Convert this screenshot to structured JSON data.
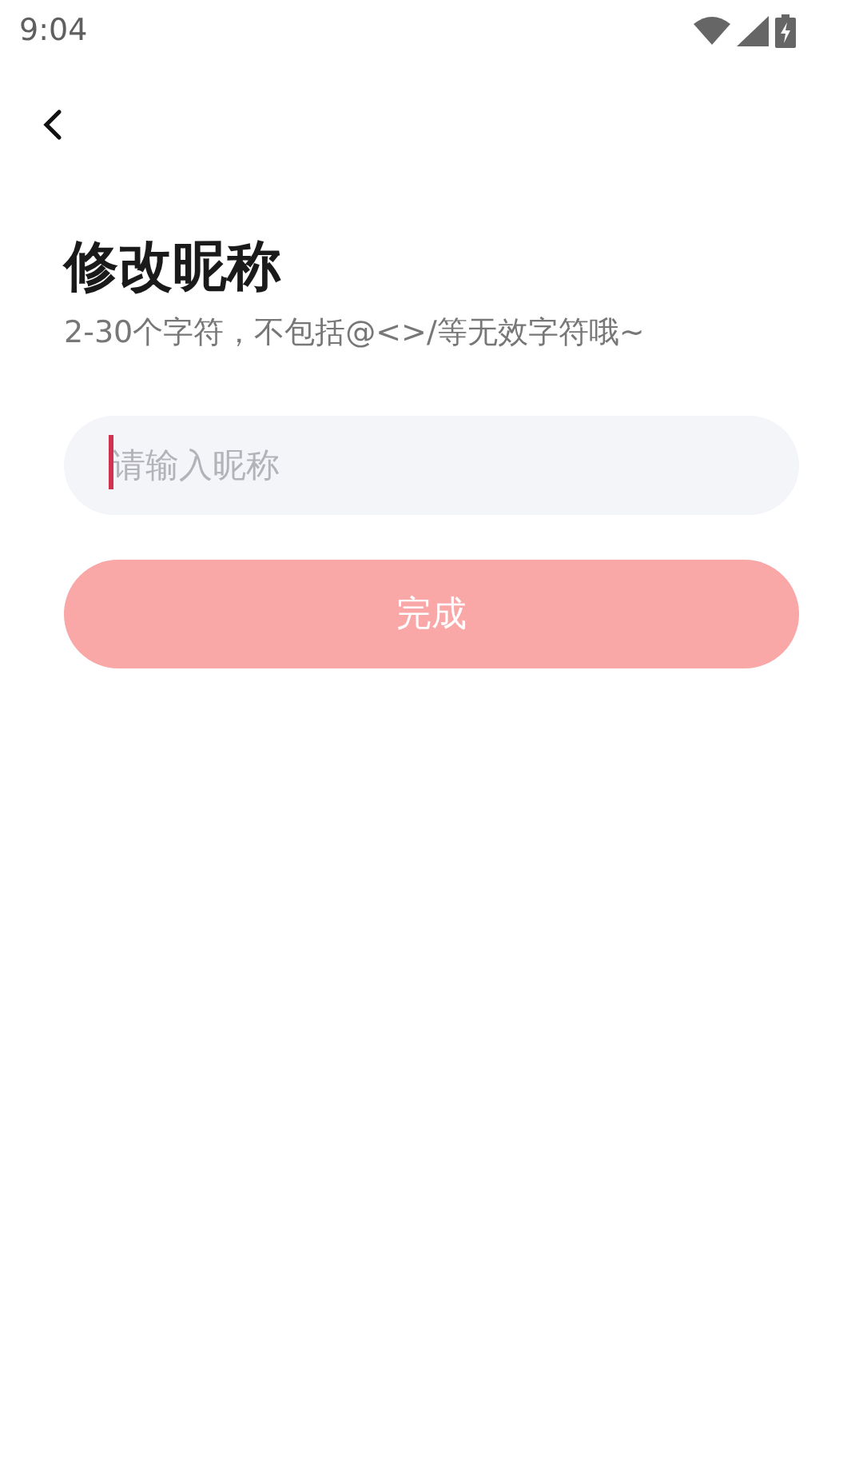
{
  "status_bar": {
    "time": "9:04"
  },
  "title": "修改昵称",
  "hint": "2-30个字符，不包括@<>/等无效字符哦~",
  "nickname_field": {
    "placeholder": "请输入昵称",
    "focused": true
  },
  "done_button": {
    "label": "完成",
    "disabled": true
  }
}
